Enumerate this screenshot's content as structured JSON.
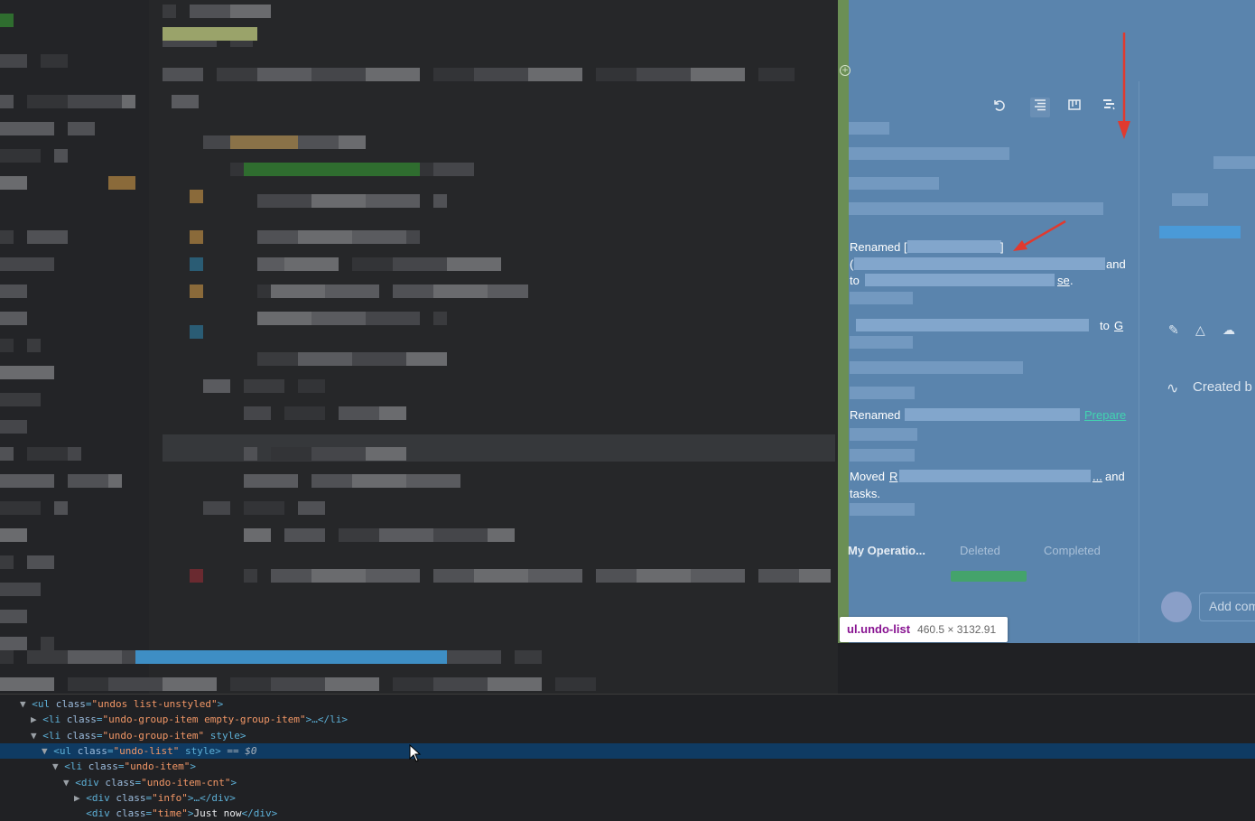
{
  "activity": {
    "renamed_1": "Renamed [",
    "renamed_1_close": "]",
    "renamed_1_paren": "(",
    "renamed_1_and": "and",
    "renamed_1_to": "to",
    "renamed_1_link_end": "se",
    "renamed_1_dot": ".",
    "moved_to": "to",
    "moved_to_link": "G",
    "renamed_2": "Renamed",
    "renamed_2_link": "Prepare",
    "moved": "Moved",
    "moved_link": "R",
    "moved_ellipsis": "...",
    "moved_and": "and",
    "moved_tasks": "tasks."
  },
  "tabs": [
    "My Operatio...",
    "Deleted",
    "Completed"
  ],
  "side": {
    "created_label": "Created b",
    "add_comment": "Add com"
  },
  "tooltip": {
    "selector": "ul.undo-list",
    "size": "460.5 × 3132.91"
  },
  "colors": {
    "page_bg": "#5480ab",
    "link": "#42d3b0",
    "arrow": "#e03a2f",
    "selected_row": "#0f3b63"
  },
  "devtools": {
    "lines": [
      {
        "tri": "▼",
        "tag_open": "<ul ",
        "attr": "class",
        "val": "\"undos list-unstyled\"",
        "tail": ">",
        "suffix": ""
      },
      {
        "tri": "▶",
        "tag_open": "<li ",
        "attr": "class",
        "val": "\"undo-group-item empty-group-item\"",
        "tail": ">…</li>",
        "suffix": ""
      },
      {
        "tri": "▼",
        "tag_open": "<li ",
        "attr": "class",
        "val": "\"undo-group-item\"",
        "tail": " style>",
        "suffix": ""
      },
      {
        "tri": "▼",
        "tag_open": "<ul ",
        "attr": "class",
        "val": "\"undo-list\"",
        "tail": " style>",
        "suffix": " == $0"
      },
      {
        "tri": "▼",
        "tag_open": "<li ",
        "attr": "class",
        "val": "\"undo-item\"",
        "tail": ">",
        "suffix": ""
      },
      {
        "tri": "▼",
        "tag_open": "<div ",
        "attr": "class",
        "val": "\"undo-item-cnt\"",
        "tail": ">",
        "suffix": ""
      },
      {
        "tri": "▶",
        "tag_open": "<div ",
        "attr": "class",
        "val": "\"info\"",
        "tail": ">…</div>",
        "suffix": ""
      },
      {
        "tri": "",
        "tag_open": "<div ",
        "attr": "class",
        "val": "\"time\"",
        "tail": ">",
        "text": "Just now",
        "close": "</div>",
        "suffix": ""
      }
    ]
  }
}
